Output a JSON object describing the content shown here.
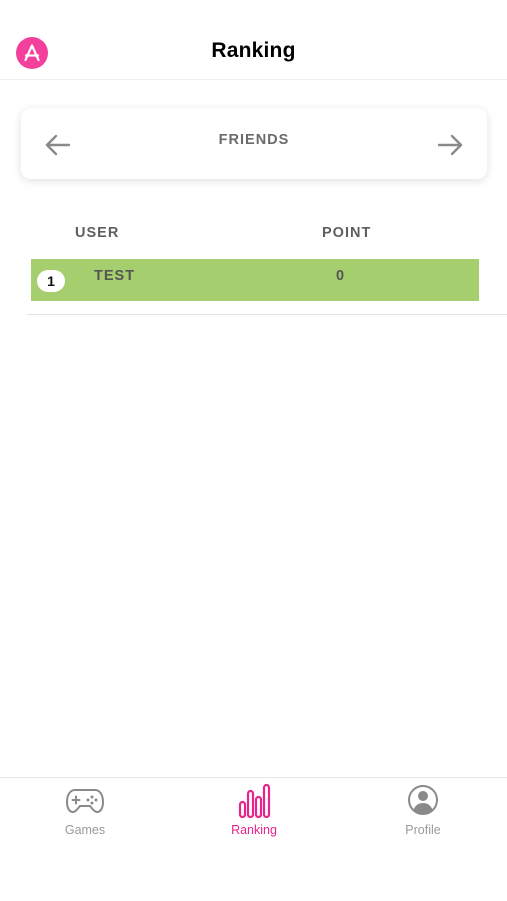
{
  "header": {
    "title": "Ranking",
    "app_icon": "app-store-a-icon",
    "accent_color": "#f2409c"
  },
  "switcher": {
    "label": "FRIENDS",
    "prev_icon": "arrow-left-icon",
    "next_icon": "arrow-right-icon"
  },
  "table": {
    "columns": [
      "USER",
      "POINT"
    ],
    "rows": [
      {
        "rank": "1",
        "user": "TEST",
        "point": "0",
        "highlight_color": "#a5cf6f"
      }
    ]
  },
  "tabbar": {
    "active_color": "#e8248c",
    "items": [
      {
        "label": "Games",
        "icon": "gamepad-icon",
        "active": false
      },
      {
        "label": "Ranking",
        "icon": "bar-chart-icon",
        "active": true
      },
      {
        "label": "Profile",
        "icon": "user-circle-icon",
        "active": false
      }
    ]
  }
}
